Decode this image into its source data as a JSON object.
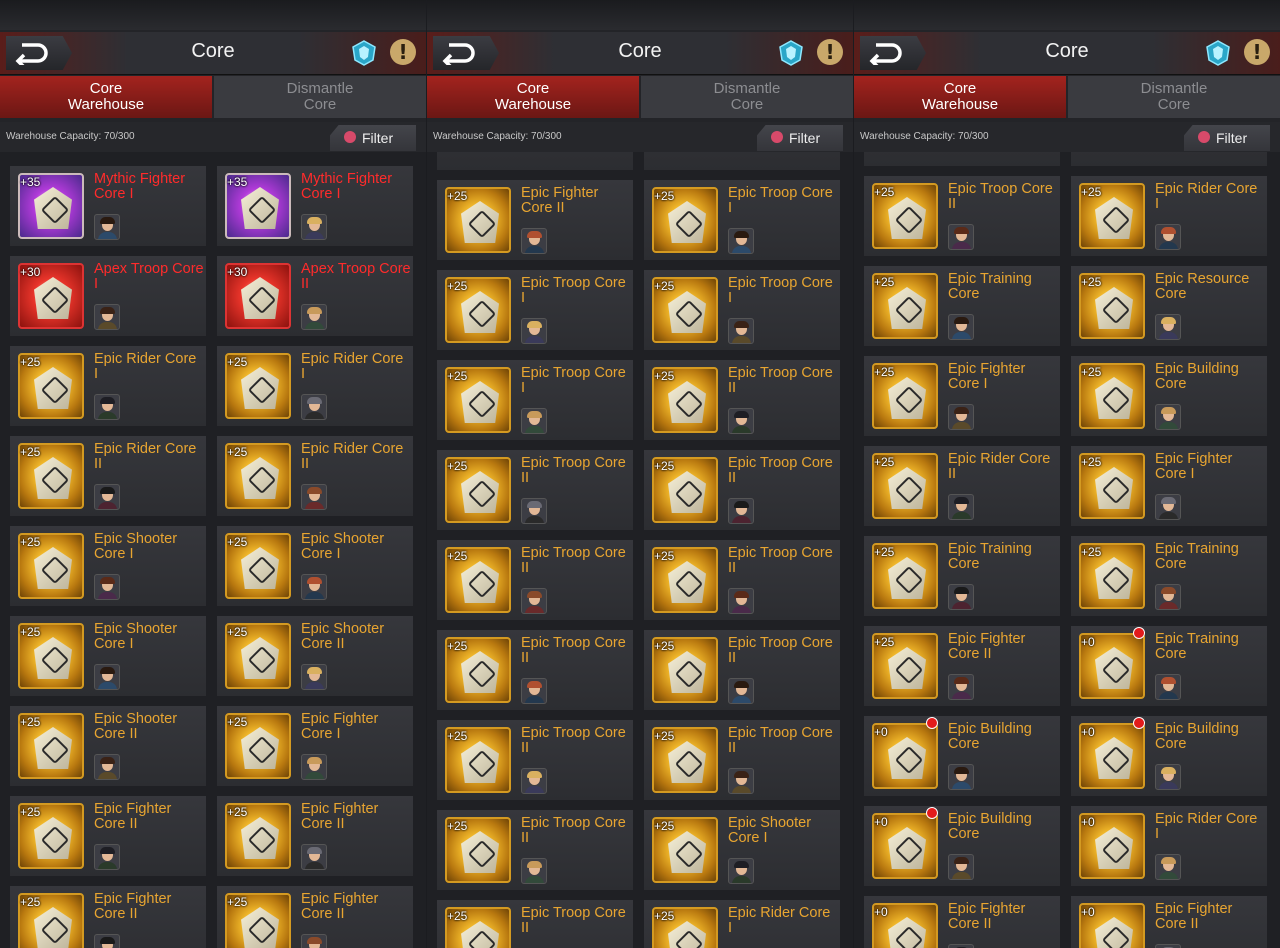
{
  "colors": {
    "epic_name": "#e8a531",
    "red_name": "#ff2b2b",
    "active_tab": "#a3231e",
    "red_dot": "#e21b1b"
  },
  "icons": {
    "back": "back-arrow-icon",
    "gem": "crystal-gem-icon",
    "info": "exclamation-icon",
    "filter": "filter-icon"
  },
  "panels": [
    {
      "title": "Core",
      "tabs": {
        "warehouse": "Core\nWarehouse",
        "dismantle": "Dismantle\nCore"
      },
      "capacity": "Warehouse Capacity: 70/300",
      "filter_label": "Filter",
      "offset": 14,
      "cards": [
        {
          "name": "Mythic Fighter Core I",
          "level": "+35",
          "tier": "mythic",
          "dot": false
        },
        {
          "name": "Mythic Fighter Core I",
          "level": "+35",
          "tier": "mythic",
          "dot": false
        },
        {
          "name": "Apex Troop Core I",
          "level": "+30",
          "tier": "apex",
          "dot": false
        },
        {
          "name": "Apex Troop Core II",
          "level": "+30",
          "tier": "apex",
          "dot": false
        },
        {
          "name": "Epic Rider Core I",
          "level": "+25",
          "tier": "epic",
          "dot": false
        },
        {
          "name": "Epic Rider Core I",
          "level": "+25",
          "tier": "epic",
          "dot": false
        },
        {
          "name": "Epic Rider Core II",
          "level": "+25",
          "tier": "epic",
          "dot": false
        },
        {
          "name": "Epic Rider Core II",
          "level": "+25",
          "tier": "epic",
          "dot": false
        },
        {
          "name": "Epic Shooter Core I",
          "level": "+25",
          "tier": "epic",
          "dot": false
        },
        {
          "name": "Epic Shooter Core I",
          "level": "+25",
          "tier": "epic",
          "dot": false
        },
        {
          "name": "Epic Shooter Core I",
          "level": "+25",
          "tier": "epic",
          "dot": false
        },
        {
          "name": "Epic Shooter Core II",
          "level": "+25",
          "tier": "epic",
          "dot": false
        },
        {
          "name": "Epic Shooter Core II",
          "level": "+25",
          "tier": "epic",
          "dot": false
        },
        {
          "name": "Epic Fighter Core I",
          "level": "+25",
          "tier": "epic",
          "dot": false
        },
        {
          "name": "Epic Fighter Core II",
          "level": "+25",
          "tier": "epic",
          "dot": false
        },
        {
          "name": "Epic Fighter Core II",
          "level": "+25",
          "tier": "epic",
          "dot": false
        },
        {
          "name": "Epic Fighter Core II",
          "level": "+25",
          "tier": "epic",
          "dot": false
        },
        {
          "name": "Epic Fighter Core II",
          "level": "+25",
          "tier": "epic",
          "dot": false
        }
      ]
    },
    {
      "title": "Core",
      "tabs": {
        "warehouse": "Core\nWarehouse",
        "dismantle": "Dismantle\nCore"
      },
      "capacity": "Warehouse Capacity: 70/300",
      "filter_label": "Filter",
      "offset": 28,
      "cards": [
        {
          "name": "Epic Fighter Core II",
          "level": "+25",
          "tier": "epic",
          "dot": false
        },
        {
          "name": "Epic Troop Core I",
          "level": "+25",
          "tier": "epic",
          "dot": false
        },
        {
          "name": "Epic Troop Core I",
          "level": "+25",
          "tier": "epic",
          "dot": false
        },
        {
          "name": "Epic Troop Core I",
          "level": "+25",
          "tier": "epic",
          "dot": false
        },
        {
          "name": "Epic Troop Core I",
          "level": "+25",
          "tier": "epic",
          "dot": false
        },
        {
          "name": "Epic Troop Core II",
          "level": "+25",
          "tier": "epic",
          "dot": false
        },
        {
          "name": "Epic Troop Core II",
          "level": "+25",
          "tier": "epic",
          "dot": false
        },
        {
          "name": "Epic Troop Core II",
          "level": "+25",
          "tier": "epic",
          "dot": false
        },
        {
          "name": "Epic Troop Core II",
          "level": "+25",
          "tier": "epic",
          "dot": false
        },
        {
          "name": "Epic Troop Core II",
          "level": "+25",
          "tier": "epic",
          "dot": false
        },
        {
          "name": "Epic Troop Core II",
          "level": "+25",
          "tier": "epic",
          "dot": false
        },
        {
          "name": "Epic Troop Core II",
          "level": "+25",
          "tier": "epic",
          "dot": false
        },
        {
          "name": "Epic Troop Core II",
          "level": "+25",
          "tier": "epic",
          "dot": false
        },
        {
          "name": "Epic Troop Core II",
          "level": "+25",
          "tier": "epic",
          "dot": false
        },
        {
          "name": "Epic Troop Core II",
          "level": "+25",
          "tier": "epic",
          "dot": false
        },
        {
          "name": "Epic Shooter Core I",
          "level": "+25",
          "tier": "epic",
          "dot": false
        },
        {
          "name": "Epic Troop Core II",
          "level": "+25",
          "tier": "epic",
          "dot": false
        },
        {
          "name": "Epic Rider Core I",
          "level": "+25",
          "tier": "epic",
          "dot": false
        }
      ]
    },
    {
      "title": "Core",
      "tabs": {
        "warehouse": "Core\nWarehouse",
        "dismantle": "Dismantle\nCore"
      },
      "capacity": "Warehouse Capacity: 70/300",
      "filter_label": "Filter",
      "offset": 24,
      "cards": [
        {
          "name": "Epic Troop Core II",
          "level": "+25",
          "tier": "epic",
          "dot": false
        },
        {
          "name": "Epic Rider Core I",
          "level": "+25",
          "tier": "epic",
          "dot": false
        },
        {
          "name": "Epic Training Core",
          "level": "+25",
          "tier": "epic",
          "dot": false
        },
        {
          "name": "Epic Resource Core",
          "level": "+25",
          "tier": "epic",
          "dot": false
        },
        {
          "name": "Epic Fighter Core I",
          "level": "+25",
          "tier": "epic",
          "dot": false
        },
        {
          "name": "Epic Building Core",
          "level": "+25",
          "tier": "epic",
          "dot": false
        },
        {
          "name": "Epic Rider Core II",
          "level": "+25",
          "tier": "epic",
          "dot": false
        },
        {
          "name": "Epic Fighter Core I",
          "level": "+25",
          "tier": "epic",
          "dot": false
        },
        {
          "name": "Epic Training Core",
          "level": "+25",
          "tier": "epic",
          "dot": false
        },
        {
          "name": "Epic Training Core",
          "level": "+25",
          "tier": "epic",
          "dot": false
        },
        {
          "name": "Epic Fighter Core II",
          "level": "+25",
          "tier": "epic",
          "dot": false
        },
        {
          "name": "Epic Training Core",
          "level": "+0",
          "tier": "epic",
          "dot": true
        },
        {
          "name": "Epic Building Core",
          "level": "+0",
          "tier": "epic",
          "dot": true
        },
        {
          "name": "Epic Building Core",
          "level": "+0",
          "tier": "epic",
          "dot": true
        },
        {
          "name": "Epic Building Core",
          "level": "+0",
          "tier": "epic",
          "dot": true
        },
        {
          "name": "Epic Rider Core I",
          "level": "+0",
          "tier": "epic",
          "dot": false
        },
        {
          "name": "Epic Fighter Core II",
          "level": "+0",
          "tier": "epic",
          "dot": false
        },
        {
          "name": "Epic Fighter Core II",
          "level": "+0",
          "tier": "epic",
          "dot": false
        }
      ]
    }
  ]
}
